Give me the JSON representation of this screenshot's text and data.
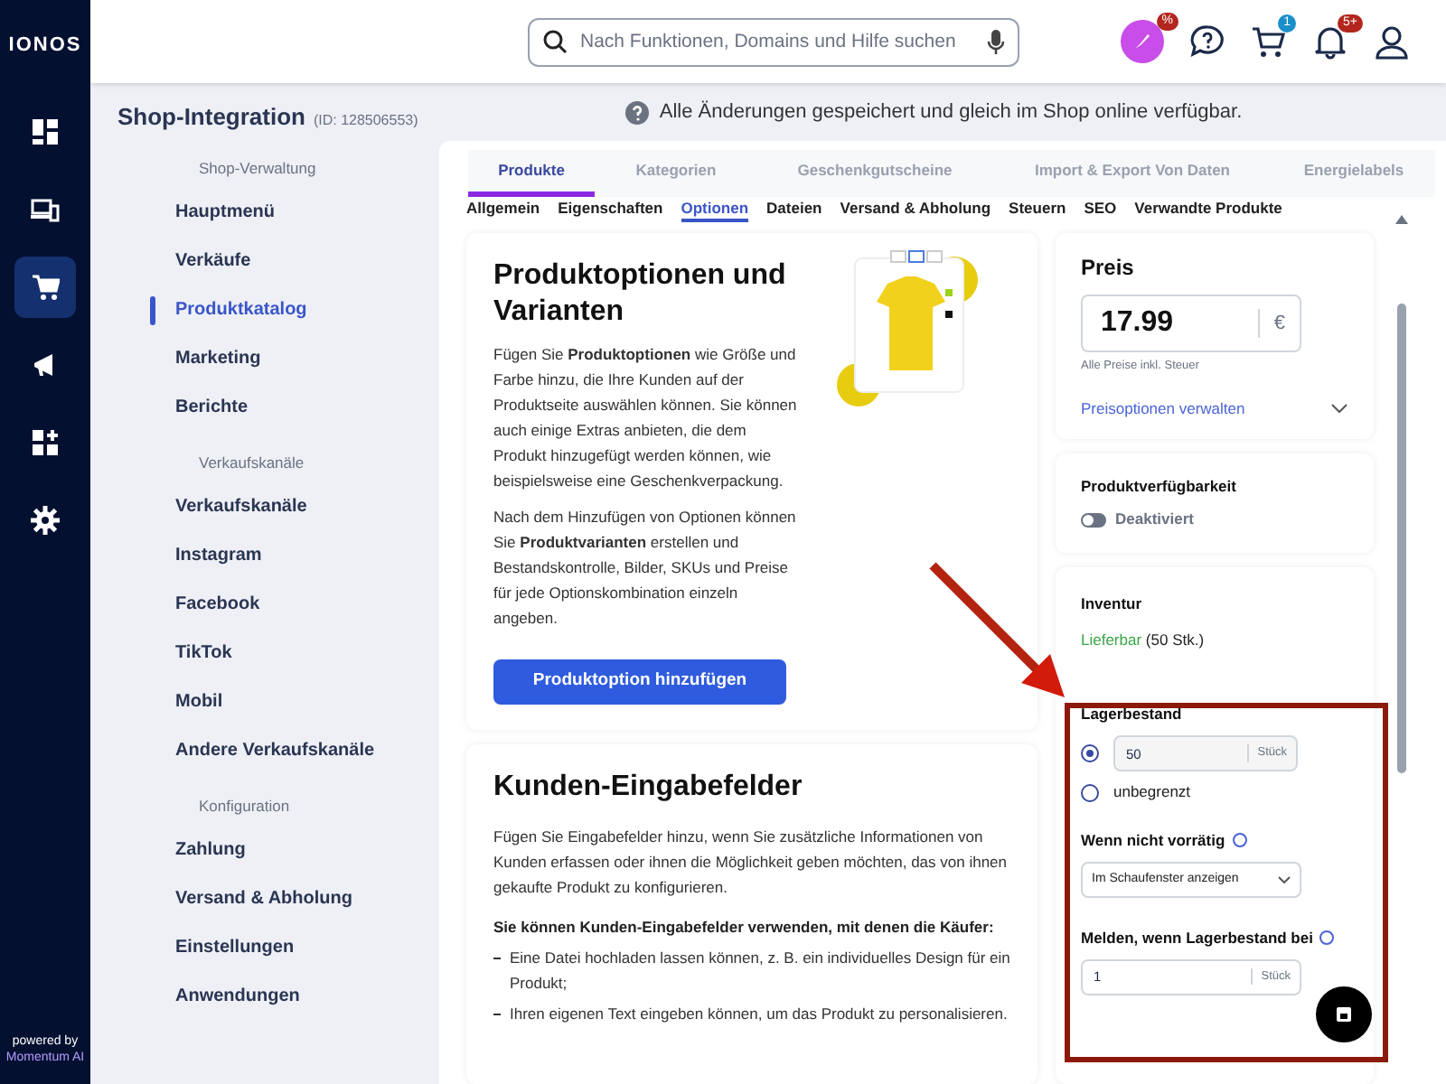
{
  "rail": {
    "logo": "IONOS",
    "items": [
      {
        "kind": "dashboard",
        "selected": false
      },
      {
        "kind": "devices",
        "selected": false
      },
      {
        "kind": "cart",
        "selected": true
      },
      {
        "kind": "megaphone",
        "selected": false
      },
      {
        "kind": "apps",
        "selected": false
      },
      {
        "kind": "gear",
        "selected": false
      }
    ],
    "powered_by": "powered by",
    "brand": "Momentum AI"
  },
  "topbar": {
    "search_placeholder": "Nach Funktionen, Domains und Hilfe suchen",
    "badges": {
      "promo": "%",
      "cart": "1",
      "notifications": "5+"
    }
  },
  "sidebar": {
    "title": "Shop-Integration",
    "id": "(ID: 128506553)",
    "groups": [
      {
        "heading": "Shop-Verwaltung",
        "items": [
          {
            "label": "Hauptmenü",
            "selected": false
          },
          {
            "label": "Verkäufe",
            "selected": false
          },
          {
            "label": "Produktkatalog",
            "selected": true
          },
          {
            "label": "Marketing",
            "selected": false
          },
          {
            "label": "Berichte",
            "selected": false
          }
        ]
      },
      {
        "heading": "Verkaufskanäle",
        "items": [
          {
            "label": "Verkaufskanäle",
            "selected": false
          },
          {
            "label": "Instagram",
            "selected": false
          },
          {
            "label": "Facebook",
            "selected": false
          },
          {
            "label": "TikTok",
            "selected": false
          },
          {
            "label": "Mobil",
            "selected": false
          },
          {
            "label": "Andere Verkaufskanäle",
            "selected": false
          }
        ]
      },
      {
        "heading": "Konfiguration",
        "items": [
          {
            "label": "Zahlung",
            "selected": false
          },
          {
            "label": "Versand & Abholung",
            "selected": false
          },
          {
            "label": "Einstellungen",
            "selected": false
          },
          {
            "label": "Anwendungen",
            "selected": false
          }
        ]
      }
    ]
  },
  "notice": "Alle Änderungen gespeichert und gleich im Shop online verfügbar.",
  "tabs": [
    {
      "label": "Produkte",
      "selected": true
    },
    {
      "label": "Kategorien",
      "selected": false
    },
    {
      "label": "Geschenkgutscheine",
      "selected": false
    },
    {
      "label": "Import & Export Von Daten",
      "selected": false
    },
    {
      "label": "Energielabels",
      "selected": false
    }
  ],
  "subtabs": [
    {
      "label": "Allgemein",
      "selected": false
    },
    {
      "label": "Eigenschaften",
      "selected": false
    },
    {
      "label": "Optionen",
      "selected": true
    },
    {
      "label": "Dateien",
      "selected": false
    },
    {
      "label": "Versand & Abholung",
      "selected": false
    },
    {
      "label": "Steuern",
      "selected": false
    },
    {
      "label": "SEO",
      "selected": false
    },
    {
      "label": "Verwandte Produkte",
      "selected": false
    }
  ],
  "options_card": {
    "title": "Produktoptionen und Varianten",
    "paragraphs": [
      "Fügen Sie **Produktoptionen** wie Größe und Farbe hinzu, die Ihre Kunden auf der Produktseite auswählen können. Sie können auch einige Extras anbieten, die dem Produkt hinzugefügt werden können, wie beispielsweise eine Geschenkverpackung.",
      "Nach dem Hinzufügen von Optionen können Sie **Produktvarianten** erstellen und Bestandskontrolle, Bilder, SKUs und Preise für jede Optionskombination einzeln angeben."
    ],
    "button": "Produktoption hinzufügen"
  },
  "fields_card": {
    "title": "Kunden-Eingabefelder",
    "intro": "Fügen Sie Eingabefelder hinzu, wenn Sie zusätzliche Informationen von Kunden erfassen oder ihnen die Möglichkeit geben möchten, das von ihnen gekaufte Produkt zu konfigurieren.",
    "lead": "Sie können Kunden-Eingabefelder verwenden, mit denen die Käufer:",
    "bullets": [
      "Eine Datei hochladen lassen können, z. B. ein individuelles Design für ein Produkt;",
      "Ihren eigenen Text eingeben können, um das Produkt zu personalisieren."
    ]
  },
  "price": {
    "label": "Preis",
    "value": "17.99",
    "currency": "€",
    "note": "Alle Preise inkl. Steuer",
    "link": "Preisoptionen verwalten"
  },
  "availability": {
    "title": "Produktverfügbarkeit",
    "on": false,
    "label": "Deaktiviert"
  },
  "inventory": {
    "title": "Inventur",
    "status": "Lieferbar",
    "count": "(50 Stk.)",
    "stock_label": "Lagerbestand",
    "options": [
      {
        "kind": "amount",
        "value": "50",
        "unit": "Stück",
        "selected": true
      },
      {
        "kind": "text",
        "label": "unbegrenzt",
        "selected": false
      }
    ],
    "out_of_stock_label": "Wenn nicht vorrätig",
    "out_of_stock_value": "Im Schaufenster anzeigen",
    "notify_label": "Melden, wenn Lagerbestand bei",
    "notify_value": "1",
    "notify_unit": "Stück"
  }
}
